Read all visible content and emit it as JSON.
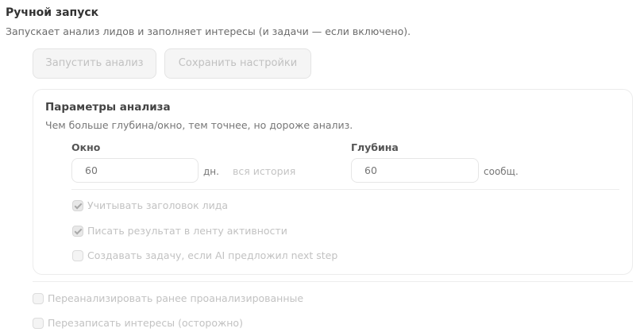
{
  "section": {
    "title": "Ручной запуск",
    "description": "Запускает анализ лидов и заполняет интересы (и задачи — если включено)."
  },
  "buttons": {
    "run_label": "Запустить анализ",
    "save_label": "Сохранить настройки"
  },
  "params": {
    "title": "Параметры анализа",
    "description": "Чем больше глубина/окно, тем точнее, но дороже анализ.",
    "window": {
      "label": "Окно",
      "placeholder": "60",
      "value": "",
      "unit": "дн.",
      "hint": "вся история"
    },
    "depth": {
      "label": "Глубина",
      "placeholder": "60",
      "value": "",
      "unit": "сообщ."
    },
    "options": [
      {
        "label": "Учитывать заголовок лида",
        "checked": true
      },
      {
        "label": "Писать результат в ленту активности",
        "checked": true
      },
      {
        "label": "Создавать задачу, если AI предложил next step",
        "checked": false
      }
    ]
  },
  "extra_options": [
    {
      "label": "Переанализировать ранее проанализированные",
      "checked": false
    },
    {
      "label": "Перезаписать интересы (осторожно)",
      "checked": false
    }
  ]
}
